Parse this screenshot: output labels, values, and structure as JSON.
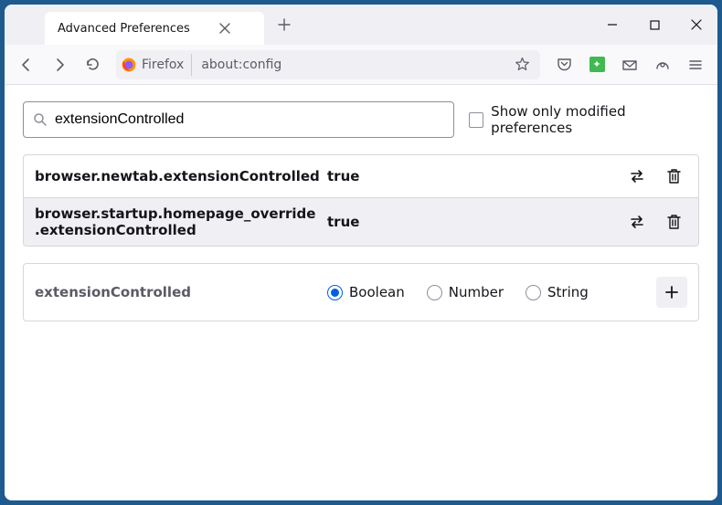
{
  "window": {
    "tab_title": "Advanced Preferences"
  },
  "urlbar": {
    "identity": "Firefox",
    "address": "about:config"
  },
  "search": {
    "value": "extensionControlled",
    "checkbox_label": "Show only modified preferences"
  },
  "prefs": [
    {
      "name": "browser.newtab.extensionControlled",
      "value": "true"
    },
    {
      "name": "browser.startup.homepage_override.extensionControlled",
      "value": "true"
    }
  ],
  "newpref": {
    "name": "extensionControlled",
    "types": {
      "boolean": "Boolean",
      "number": "Number",
      "string": "String"
    },
    "selected": "boolean"
  }
}
